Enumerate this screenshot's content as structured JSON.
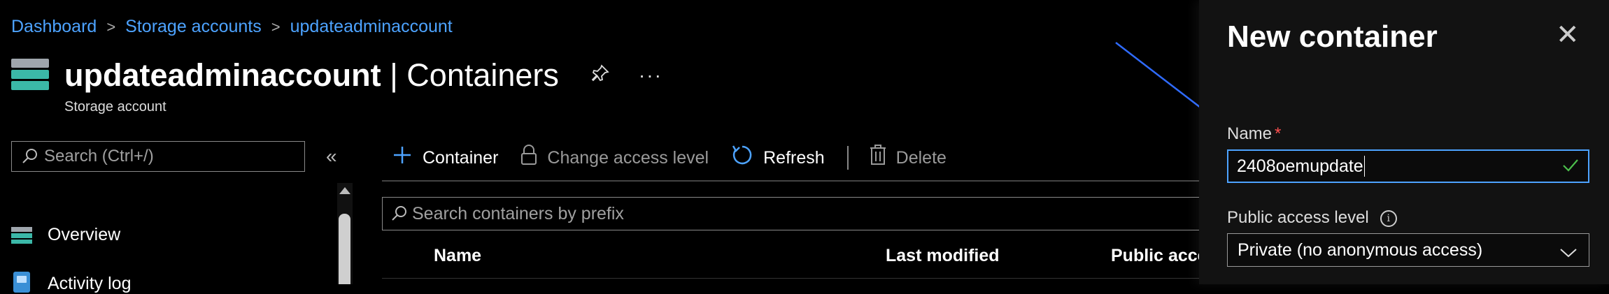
{
  "breadcrumb": {
    "items": [
      "Dashboard",
      "Storage accounts",
      "updateadminaccount"
    ],
    "separator": ">"
  },
  "header": {
    "account_name": "updateadminaccount",
    "separator": "|",
    "page": "Containers",
    "subtitle": "Storage account",
    "more": "···"
  },
  "sidebar": {
    "search_placeholder": "Search (Ctrl+/)",
    "collapse": "«",
    "items": [
      {
        "label": "Overview",
        "icon": "storage-icon"
      },
      {
        "label": "Activity log",
        "icon": "activity-log-icon"
      }
    ]
  },
  "toolbar": {
    "container_label": "Container",
    "access_level_label": "Change access level",
    "refresh_label": "Refresh",
    "delete_label": "Delete"
  },
  "main": {
    "search_placeholder": "Search containers by prefix",
    "columns": [
      "Name",
      "Last modified",
      "Public acce"
    ]
  },
  "panel": {
    "title": "New container",
    "close": "✕",
    "name_label": "Name",
    "required_mark": "*",
    "name_value": "2408oemupdate",
    "access_label": "Public access level",
    "info": "i",
    "access_value": "Private (no anonymous access)"
  },
  "colors": {
    "link": "#4da3ff",
    "accent": "#4da3ff",
    "required": "#ff5050",
    "valid": "#4cbf4c"
  }
}
